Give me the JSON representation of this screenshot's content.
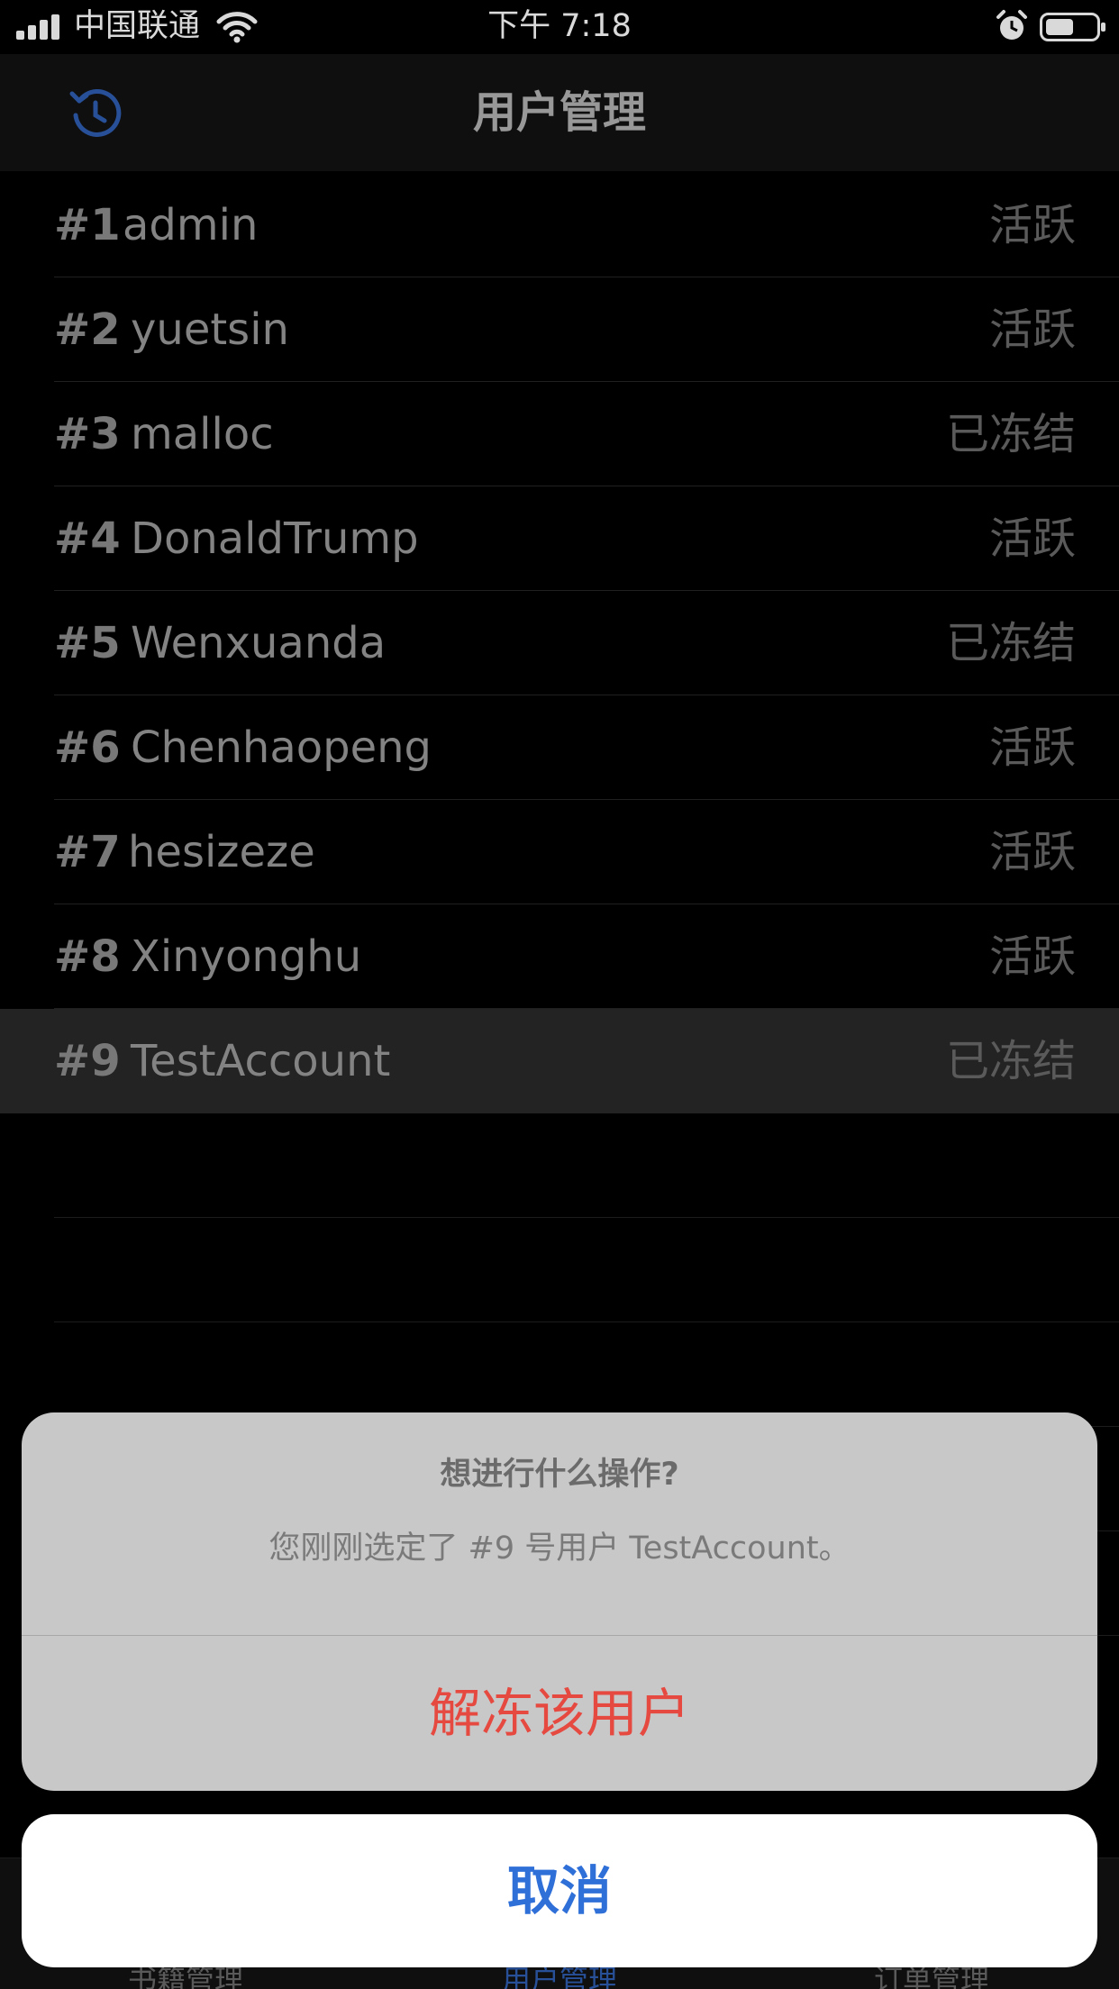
{
  "status_bar": {
    "carrier": "中国联通",
    "time": "下午 7:18"
  },
  "nav": {
    "title": "用户管理",
    "refresh_icon": "refresh-history-icon",
    "accent_color": "#2f5fb3"
  },
  "users": [
    {
      "num": "#1",
      "name": "admin",
      "state": "活跃"
    },
    {
      "num": "#2",
      "name": "yuetsin",
      "state": "活跃"
    },
    {
      "num": "#3",
      "name": "malloc",
      "state": "已冻结"
    },
    {
      "num": "#4",
      "name": "DonaldTrump",
      "state": "活跃"
    },
    {
      "num": "#5",
      "name": "Wenxuanda",
      "state": "已冻结"
    },
    {
      "num": "#6",
      "name": "Chenhaopeng",
      "state": "活跃"
    },
    {
      "num": "#7",
      "name": "hesizeze",
      "state": "活跃"
    },
    {
      "num": "#8",
      "name": "Xinyonghu",
      "state": "活跃"
    },
    {
      "num": "#9",
      "name": "TestAccount",
      "state": "已冻结"
    }
  ],
  "tabs": [
    {
      "label": "书籍管理"
    },
    {
      "label": "用户管理"
    },
    {
      "label": "订单管理"
    }
  ],
  "action_sheet": {
    "title": "想进行什么操作?",
    "message": "您刚刚选定了 #9 号用户 TestAccount。",
    "action_label": "解冻该用户",
    "action_color": "#e5493f",
    "cancel_label": "取消",
    "cancel_color": "#2f6fd8"
  }
}
